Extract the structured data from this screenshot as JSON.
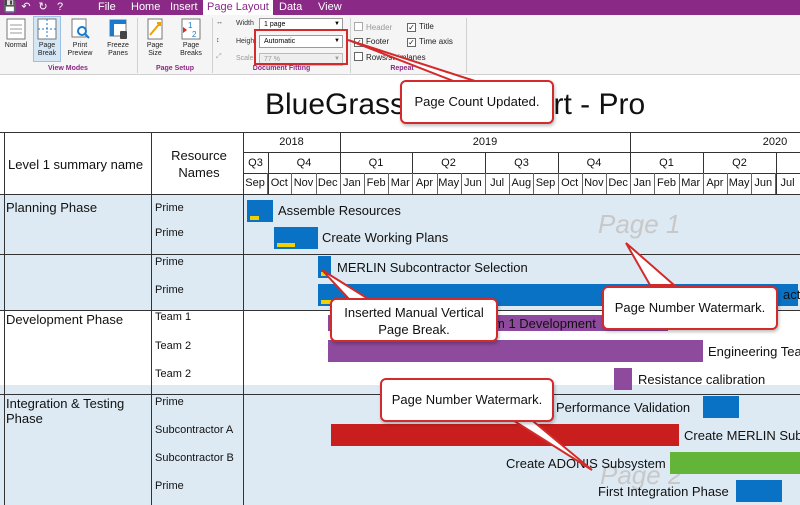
{
  "menu": {
    "items": [
      "File",
      "Home",
      "Insert",
      "Page Layout",
      "Data",
      "View"
    ],
    "active": "Page Layout"
  },
  "ribbon": {
    "view_modes": {
      "label": "View Modes",
      "buttons": [
        "Normal",
        "Page Break",
        "Print Preview",
        "Freeze Panes"
      ]
    },
    "page_setup": {
      "label": "Page Setup",
      "buttons": [
        "Page Size",
        "Page Breaks"
      ]
    },
    "document_fitting": {
      "label": "Document Fitting",
      "width_label": "Width",
      "width_value": "1 page",
      "height_label": "Height",
      "height_value": "Automatic",
      "scale_label": "Scale",
      "scale_value": "77 %"
    },
    "repeat": {
      "label": "Repeat",
      "header": "Header",
      "title": "Title",
      "footer": "Footer",
      "time_axis": "Time axis",
      "rows_swimlanes": "Rows/swimlanes"
    }
  },
  "report": {
    "title": "BlueGrass Plan Report - Pro",
    "col1_header": "Level 1 summary name",
    "col2_header": "Resource Names",
    "years": [
      "2018",
      "2019",
      "2020"
    ],
    "quarters": [
      "Q3",
      "Q4",
      "Q1",
      "Q2",
      "Q3",
      "Q4",
      "Q1",
      "Q2"
    ],
    "months": [
      "Sep",
      "Oct",
      "Nov",
      "Dec",
      "Jan",
      "Feb",
      "Mar",
      "Apr",
      "May",
      "Jun",
      "Jul",
      "Aug",
      "Sep",
      "Oct",
      "Nov",
      "Dec",
      "Jan",
      "Feb",
      "Mar",
      "Apr",
      "May",
      "Jun",
      "Jul"
    ],
    "phases": [
      "Planning Phase",
      "Development Phase",
      "Integration & Testing Phase"
    ],
    "resources": [
      "Prime",
      "Prime",
      "Prime",
      "Prime",
      "Team 1",
      "Team 2",
      "Team 2",
      "Prime",
      "Subcontractor A",
      "Subcontractor B",
      "Prime"
    ],
    "tasks": [
      "Assemble Resources",
      "Create Working Plans",
      "MERLIN Subcontractor Selection",
      "act",
      "m 1 Development",
      "Engineering Tea",
      "Resistance calibration",
      "Performance Validation",
      "Create MERLIN Sub",
      "Create ADONIS Subsystem",
      "First Integration Phase"
    ],
    "watermarks": [
      "Page 1",
      "Page 2"
    ]
  },
  "callouts": {
    "page_count": "Page Count Updated.",
    "page_break": "Inserted Manual Vertical Page Break.",
    "watermark_1": "Page Number Watermark.",
    "watermark_2": "Page Number Watermark."
  },
  "colors": {
    "brand": "#8a2a86",
    "callout_border": "#d32b2b",
    "blue_bar": "#0a72c4",
    "purple_bar": "#8e4a9c",
    "red_bar": "#c81e1e",
    "green_bar": "#63b53a",
    "progress": "#f0d000",
    "row_shade": "#ddeaf3"
  }
}
